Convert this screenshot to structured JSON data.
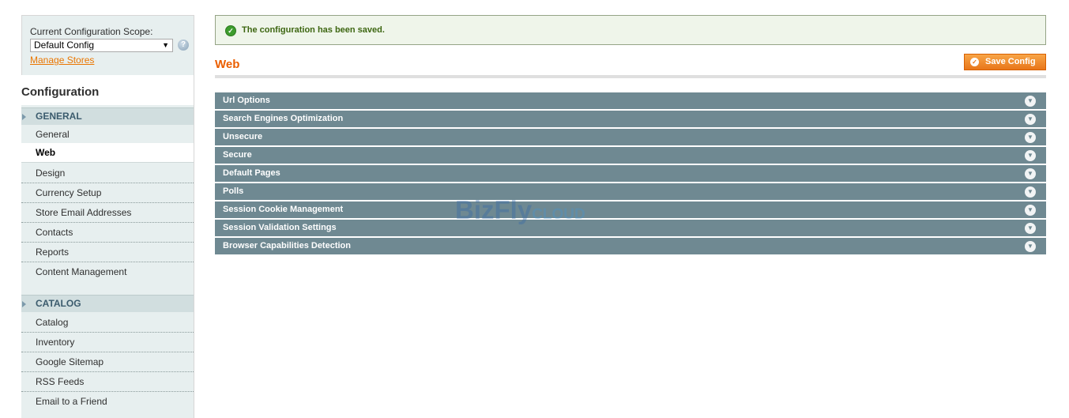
{
  "sidebar": {
    "scope_label": "Current Configuration Scope:",
    "scope_value": "Default Config",
    "manage_stores": "Manage Stores",
    "config_title": "Configuration",
    "groups": [
      {
        "title": "GENERAL",
        "items": [
          "General",
          "Web",
          "Design",
          "Currency Setup",
          "Store Email Addresses",
          "Contacts",
          "Reports",
          "Content Management"
        ]
      },
      {
        "title": "CATALOG",
        "items": [
          "Catalog",
          "Inventory",
          "Google Sitemap",
          "RSS Feeds",
          "Email to a Friend"
        ]
      }
    ],
    "active_item": "Web"
  },
  "message": {
    "text": "The configuration has been saved."
  },
  "main": {
    "title": "Web",
    "save_label": "Save Config",
    "sections": [
      "Url Options",
      "Search Engines Optimization",
      "Unsecure",
      "Secure",
      "Default Pages",
      "Polls",
      "Session Cookie Management",
      "Session Validation Settings",
      "Browser Capabilities Detection"
    ]
  },
  "watermark": {
    "brand": "BizFly",
    "suffix": "CLOUD"
  },
  "colors": {
    "accent": "#eb5e00",
    "section_bar": "#6f8992",
    "sidebar_bg": "#e7efef",
    "success": "#3d9c2d"
  }
}
